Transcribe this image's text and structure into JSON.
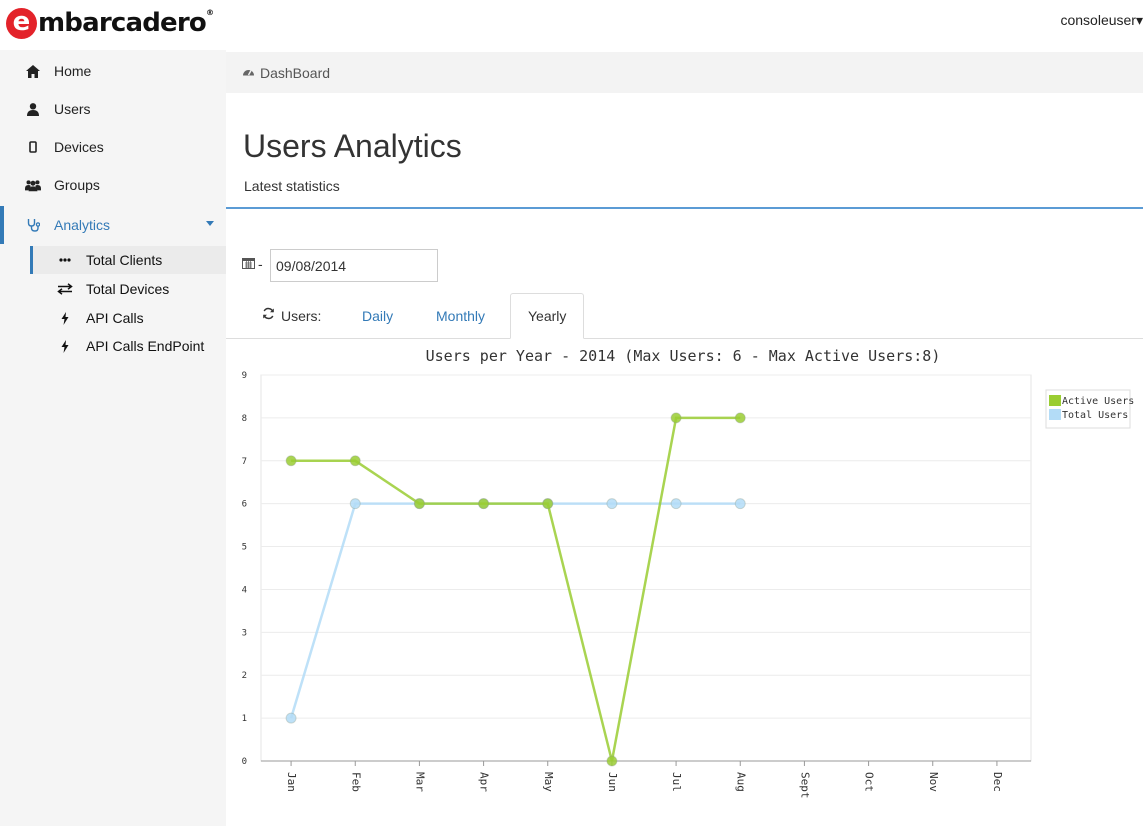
{
  "brand": {
    "logo_e": "e",
    "logo_text": "mbarcadero",
    "logo_reg": "®"
  },
  "user_menu": {
    "label": "consoleuser",
    "caret": "▾"
  },
  "sidebar": {
    "items": [
      {
        "label": "Home",
        "icon": "home-icon"
      },
      {
        "label": "Users",
        "icon": "user-icon"
      },
      {
        "label": "Devices",
        "icon": "mobile-icon"
      },
      {
        "label": "Groups",
        "icon": "group-icon"
      },
      {
        "label": "Analytics",
        "icon": "stethoscope-icon",
        "active": true
      }
    ],
    "subitems": [
      {
        "label": "Total Clients",
        "icon": "ellipsis-icon",
        "active": true
      },
      {
        "label": "Total Devices",
        "icon": "exchange-icon"
      },
      {
        "label": "API Calls",
        "icon": "bolt-icon"
      },
      {
        "label": "API Calls EndPoint",
        "icon": "bolt-icon"
      }
    ]
  },
  "breadcrumb": {
    "label": "DashBoard",
    "icon": "dashboard-icon"
  },
  "page": {
    "title": "Users Analytics",
    "subtitle": "Latest statistics"
  },
  "filter": {
    "date_separator": "-",
    "date_value": "09/08/2014"
  },
  "tabs": {
    "label": "Users:",
    "items": [
      {
        "label": "Daily"
      },
      {
        "label": "Monthly"
      },
      {
        "label": "Yearly",
        "active": true
      }
    ]
  },
  "colors": {
    "accent": "#337ab7",
    "active_users": "#9acd32",
    "total_users": "#b3dcf7"
  },
  "chart_data": {
    "type": "line",
    "title": "Users per Year - 2014 (Max Users: 6 - Max Active Users:8)",
    "categories": [
      "Jan",
      "Feb",
      "Mar",
      "Apr",
      "May",
      "Jun",
      "Jul",
      "Aug",
      "Sept",
      "Oct",
      "Nov",
      "Dec"
    ],
    "series": [
      {
        "name": "Active Users",
        "color": "#9acd32",
        "values": [
          7,
          7,
          6,
          6,
          6,
          0,
          8,
          8
        ]
      },
      {
        "name": "Total Users",
        "color": "#b3dcf7",
        "values": [
          1,
          6,
          6,
          6,
          6,
          6,
          6,
          6
        ]
      }
    ],
    "ylim": [
      0,
      9
    ],
    "yticks": [
      0,
      1,
      2,
      3,
      4,
      5,
      6,
      7,
      8,
      9
    ],
    "grid": true,
    "legend": "top-right"
  }
}
